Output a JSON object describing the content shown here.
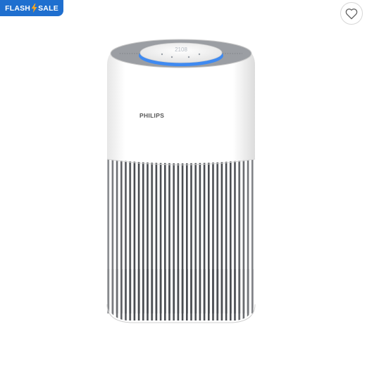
{
  "badge": {
    "label_left": "FLASH",
    "label_right": "SALE",
    "icon": "lightning-bolt-icon",
    "background": "#1f6fcf",
    "bolt_color": "#f5a623"
  },
  "favorite": {
    "icon": "heart-outline-icon"
  },
  "product": {
    "brand": "PHILIPS",
    "display_text": "2108",
    "ring_color": "#2f86ff"
  }
}
